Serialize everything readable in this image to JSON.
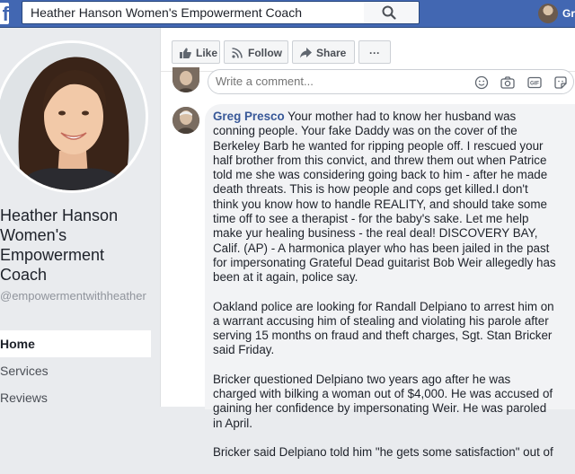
{
  "topbar": {
    "logo": "f",
    "search_value": "Heather Hanson Women's Empowerment Coach",
    "user_name": "Gr",
    "accent_color": "#4267b2"
  },
  "page": {
    "name": "Heather Hanson Women's Empowerment Coach",
    "handle": "@empowermentwithheather",
    "nav": [
      {
        "label": "Home",
        "active": true
      },
      {
        "label": "Services",
        "active": false
      },
      {
        "label": "Reviews",
        "active": false
      }
    ]
  },
  "actions": {
    "like": "Like",
    "follow": "Follow",
    "share": "Share",
    "more": "···"
  },
  "comment_box": {
    "placeholder": "Write a comment..."
  },
  "comment": {
    "author": "Greg Presco",
    "paragraphs": [
      "Your mother had to know her husband was conning people. Your fake Daddy was on the cover of the Berkeley Barb he wanted for ripping people off. I rescued your half brother from this convict, and threw them out when Patrice told me she was considering going back to him - after he made death threats. This is how people and cops get killed.I don't think you know how to handle REALITY, and should take some time off to see a therapist - for the baby's sake. Let me help make yur healing business - the real deal! DISCOVERY BAY, Calif. (AP) - A harmonica player who has been jailed in the past for impersonating Grateful Dead guitarist Bob Weir allegedly has been at it again, police say.",
      "Oakland police are looking for Randall Delpiano to arrest him on a warrant accusing him of stealing and violating his parole after serving 15 months on fraud and theft charges, Sgt. Stan Bricker said Friday.",
      "Bricker questioned Delpiano two years ago after he was charged with bilking a woman out of $4,000. He was accused of gaining her confidence by impersonating Weir. He was paroled in April.",
      "Bricker said Delpiano told him \"he gets some satisfaction\" out of"
    ]
  }
}
